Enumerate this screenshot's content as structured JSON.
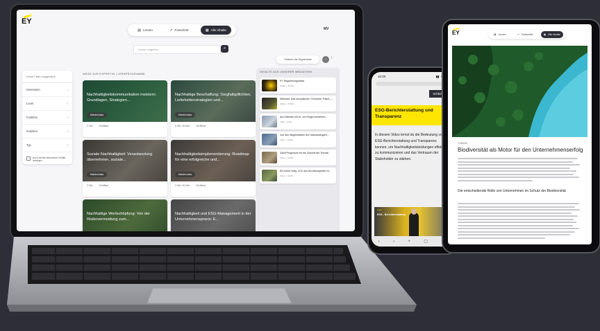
{
  "brand": {
    "logo": "EY",
    "accent": "#ffe600",
    "dark": "#2e2e38"
  },
  "laptop": {
    "nav": [
      {
        "icon": "book-icon",
        "label": "Lernen"
      },
      {
        "icon": "progress-icon",
        "label": "Fortschritt"
      },
      {
        "icon": "grid-icon",
        "label": "Alle Inhalte"
      }
    ],
    "user_initials": "MV",
    "search_placeholder": "Suche eingeben",
    "sort_label": "Sortiere die Ergebnisse",
    "filters": {
      "header": "Keine Filter ausgewählt",
      "items": [
        "Interessen",
        "Level",
        "Funktion",
        "Industrie",
        "Typ"
      ],
      "checkbox_label": "Auch bereits absolvierte Inhalte anzeigen"
    },
    "section_left": "WEGE ZUR EXPERT:IN | LERNPROGRAMME",
    "section_right": "INHALTE AUS UNSERER MEDIATHEK",
    "cards": [
      {
        "title": "Nachhaltigkeitskommunikation meistern: Grundlagen, Strategien...",
        "badge": "Masterclass",
        "meta1": "2 Std.",
        "meta2": "Zertifikat"
      },
      {
        "title": "Nachhaltige Beschaffung: Sorgfaltspflichten, Lieferkettenstrategien und...",
        "badge": "Masterclass",
        "meta1": "6 Std. 30 Min.",
        "meta2": "Zertifikat"
      },
      {
        "title": "Soziale Nachhaltigkeit: Verantwortung übernehmen, soziale...",
        "badge": "Masterclass",
        "meta1": "3 Std.",
        "meta2": "Zertifikat"
      },
      {
        "title": "Nachhaltigkeitsimplementierung: Roadmap für eine erfolgreiche und...",
        "badge": "Masterclass",
        "meta1": "2 Std. 40 Min.",
        "meta2": "Zertifikat"
      },
      {
        "title": "Nachhaltige Wertschöpfung: Von der Risikovermeidung zum...",
        "badge": "",
        "meta1": "",
        "meta2": ""
      },
      {
        "title": "Nachhaltigkeit und ESG-Management in der Unternehmenspraxis: E...",
        "badge": "",
        "meta1": "",
        "meta2": ""
      }
    ],
    "media": [
      {
        "title": "EY Regulierungsradar",
        "meta1": "Artikel",
        "meta2": "20 Min."
      },
      {
        "title": "Webcast: Das europäische \"Omnibus\"-Paket –...",
        "meta1": "Artikel",
        "meta2": "20 Min."
      },
      {
        "title": "Auf Zeitreise mit KI, um Ringel verstehen...",
        "meta1": "Video",
        "meta2": "5 Min."
      },
      {
        "title": "Von den Möglichkeiten der Naturanalogien...",
        "meta1": "Video",
        "meta2": "10 Min."
      },
      {
        "title": "Zwölf Prognosen für die Zukunft der Technik",
        "meta1": "Video",
        "meta2": "10 Min."
      },
      {
        "title": "Ein neuer Weg, CO2 aus der Atmosphäre zu...",
        "meta1": "Video",
        "meta2": "10 Min."
      }
    ]
  },
  "phone": {
    "time": "10:20",
    "close_label": "Schließen",
    "title": "ESG-Berichterstattung und Transparenz",
    "body": "In diesem Video lernst du die Bedeutung von ESG-Berichterstattung und Transparenz kennen, um Nachhaltigkeitsleistungen effektiv zu kommunizieren und das Vertrauen der Stakeholder zu stärken.",
    "video_title": "ESG - Berichterstattung"
  },
  "tablet": {
    "nav": [
      {
        "icon": "book-icon",
        "label": "Lernen"
      },
      {
        "icon": "progress-icon",
        "label": "Fortschritt"
      },
      {
        "icon": "grid-icon",
        "label": "Alle Inhalte"
      }
    ],
    "kicker": "TI BASIS",
    "title": "Biodiversität als Motor für den Unternehmenserfolg",
    "subtitle": "Die entscheidende Rolle von Unternehmen im Schutz der Biodiversität"
  }
}
